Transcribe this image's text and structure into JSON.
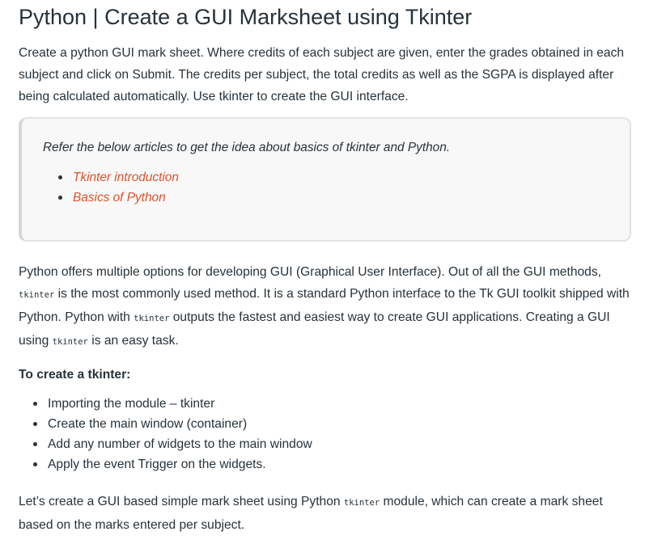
{
  "title": "Python | Create a GUI Marksheet using Tkinter",
  "intro": "Create a python GUI mark sheet. Where credits of each subject are given, enter the grades obtained in each subject and click on Submit. The credits per subject, the total credits as well as the SGPA is displayed after being calculated automatically. Use tkinter to create the GUI interface.",
  "blockquote": {
    "text": "Refer the below articles to get the idea about basics of tkinter and Python.",
    "links": [
      "Tkinter introduction",
      "Basics of Python"
    ]
  },
  "para2": {
    "p1": "Python offers multiple options for developing GUI (Graphical User Interface). Out of all the GUI methods, ",
    "code1": "tkinter",
    "p2": " is the most commonly used method. It is a standard Python interface to the Tk GUI toolkit shipped with Python. Python with ",
    "code2": "tkinter",
    "p3": " outputs the fastest and easiest way to create GUI applications. Creating a GUI using ",
    "code3": "tkinter",
    "p4": " is an easy task."
  },
  "subhead": "To create a tkinter:",
  "steps": [
    "Importing the module – tkinter",
    "Create the main window (container)",
    "Add any number of widgets to the main window",
    "Apply the event Trigger on the widgets."
  ],
  "para3": {
    "p1": "Let’s create a GUI based simple mark sheet using Python ",
    "code1": "tkinter",
    "p2": " module, which can create a mark sheet based on the marks entered per subject."
  }
}
